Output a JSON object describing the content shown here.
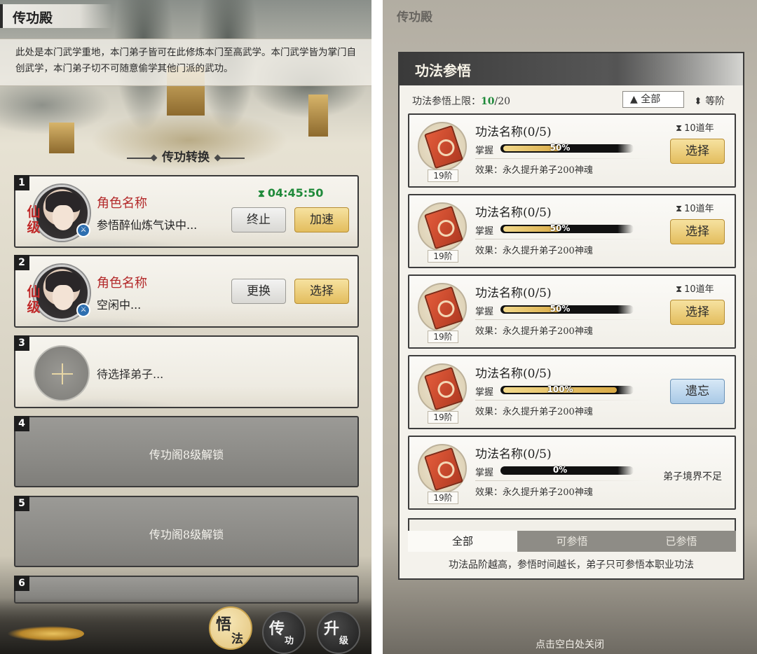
{
  "left": {
    "title": "传功殿",
    "intro": "此处是本门武学重地，本门弟子皆可在此修炼本门至高武学。本门武学皆为掌门自创武学，本门弟子切不可随意偷学其他门派的武功。",
    "section_title": "传功转换",
    "slots": [
      {
        "num": "1",
        "tag": "仙\n级",
        "name": "角色名称",
        "status": "参悟醉仙炼气诀中...",
        "timer": "04:45:50",
        "btn1": "终止",
        "btn2": "加速"
      },
      {
        "num": "2",
        "tag": "仙\n级",
        "name": "角色名称",
        "status": "空闲中...",
        "btn1": "更换",
        "btn2": "选择"
      },
      {
        "num": "3",
        "wait": "待选择弟子..."
      },
      {
        "num": "4",
        "locked": "传功阁8级解锁"
      },
      {
        "num": "5",
        "locked": "传功阁8级解锁"
      },
      {
        "num": "6"
      }
    ],
    "bottom": {
      "btn_active": {
        "c1": "悟",
        "c2": "法"
      },
      "btn2": {
        "c1": "传",
        "c2": "功"
      },
      "btn3": {
        "c1": "升",
        "c2": "级"
      }
    }
  },
  "right": {
    "bg_title": "传功殿",
    "dialog_title": "功法参悟",
    "limit_label": "功法参悟上限：",
    "limit_value": "10",
    "limit_max": "/20",
    "filter": "▲ 全部",
    "sort": "等阶",
    "skills": [
      {
        "name": "功法名称(0/5)",
        "mastery_label": "掌握",
        "pct": "50%",
        "progress": 0.5,
        "effect": "效果：永久提升弟子200神魂",
        "rank": "19阶",
        "duration": "10道年",
        "action": "选择"
      },
      {
        "name": "功法名称(0/5)",
        "mastery_label": "掌握",
        "pct": "50%",
        "progress": 0.5,
        "effect": "效果：永久提升弟子200神魂",
        "rank": "19阶",
        "duration": "10道年",
        "action": "选择"
      },
      {
        "name": "功法名称(0/5)",
        "mastery_label": "掌握",
        "pct": "50%",
        "progress": 0.5,
        "effect": "效果：永久提升弟子200神魂",
        "rank": "19阶",
        "duration": "10道年",
        "action": "选择"
      },
      {
        "name": "功法名称(0/5)",
        "mastery_label": "掌握",
        "pct": "100%",
        "progress": 1.0,
        "effect": "效果：永久提升弟子200神魂",
        "rank": "19阶",
        "action": "遗忘"
      },
      {
        "name": "功法名称(0/5)",
        "mastery_label": "掌握",
        "pct": "0%",
        "progress": 0.0,
        "effect": "效果：永久提升弟子200神魂",
        "rank": "19阶",
        "note": "弟子境界不足"
      }
    ],
    "tabs": [
      "全部",
      "可参悟",
      "已参悟"
    ],
    "footer": "功法品阶越高，参悟时间越长，弟子只可参悟本职业功法",
    "close_hint": "点击空白处关闭"
  }
}
